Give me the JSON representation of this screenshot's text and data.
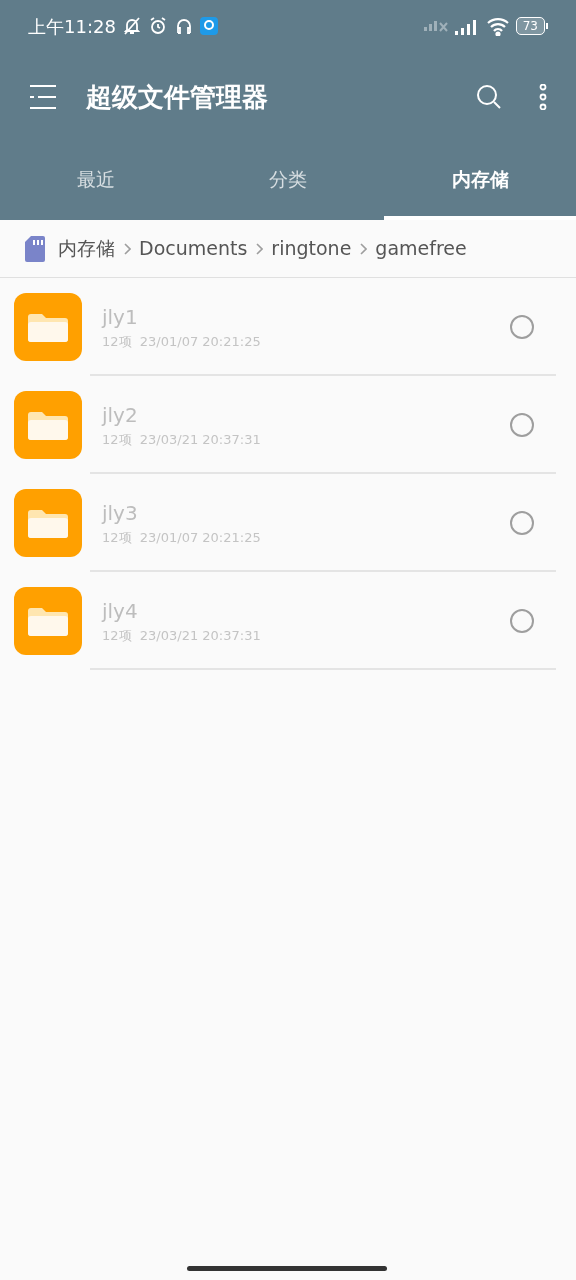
{
  "status_bar": {
    "time": "上午11:28",
    "battery": "73"
  },
  "app_bar": {
    "title": "超级文件管理器"
  },
  "tabs": [
    {
      "label": "最近",
      "selected": false
    },
    {
      "label": "分类",
      "selected": false
    },
    {
      "label": "内存储",
      "selected": true
    }
  ],
  "breadcrumb": [
    "内存储",
    "Documents",
    "ringtone",
    "gamefree"
  ],
  "files": [
    {
      "name": "jly1",
      "meta": "12项  23/01/07 20:21:25",
      "checked": false
    },
    {
      "name": "jly2",
      "meta": "12项  23/03/21 20:37:31",
      "checked": false
    },
    {
      "name": "jly3",
      "meta": "12项  23/01/07 20:21:25",
      "checked": false
    },
    {
      "name": "jly4",
      "meta": "12项  23/03/21 20:37:31",
      "checked": false
    }
  ]
}
